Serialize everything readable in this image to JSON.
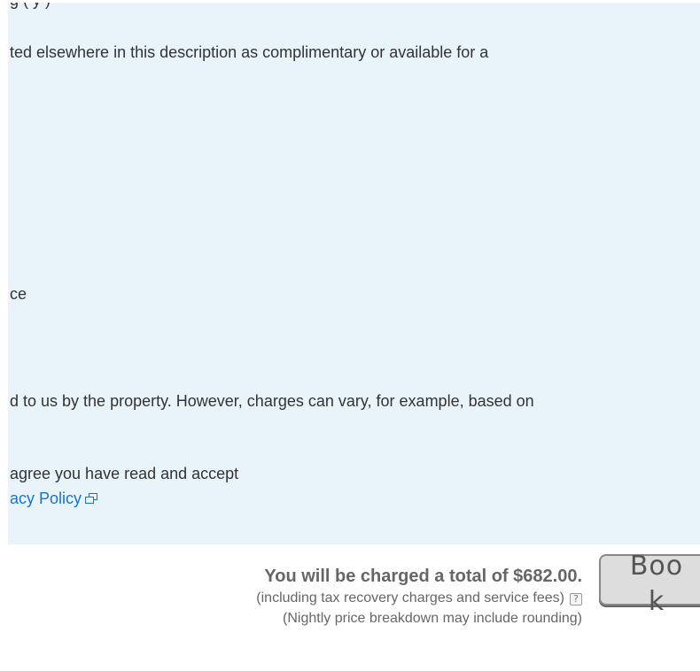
{
  "policy_panel": {
    "clipped_top_line": "g    (                            y            )",
    "line1": "ted elsewhere in this description as complimentary or available for a",
    "line2": "ce",
    "line3": "d to us by the property. However, charges can vary, for example, based on",
    "line4": "agree you have read and accept",
    "line5_link": "acy Policy"
  },
  "summary": {
    "total_text": "You will be charged a total of $682.00.",
    "includes_text": "(including tax recovery charges and service fees)",
    "help_icon_glyph": "?",
    "rounding_text": "(Nightly price breakdown may include rounding)"
  },
  "book_button": {
    "label": "Book"
  },
  "icons": {
    "external_link": "external-link-icon",
    "help": "help-icon"
  },
  "colors": {
    "panel_bg": "#e8f4fa",
    "link": "#1a73c8",
    "muted_text": "#666666"
  }
}
